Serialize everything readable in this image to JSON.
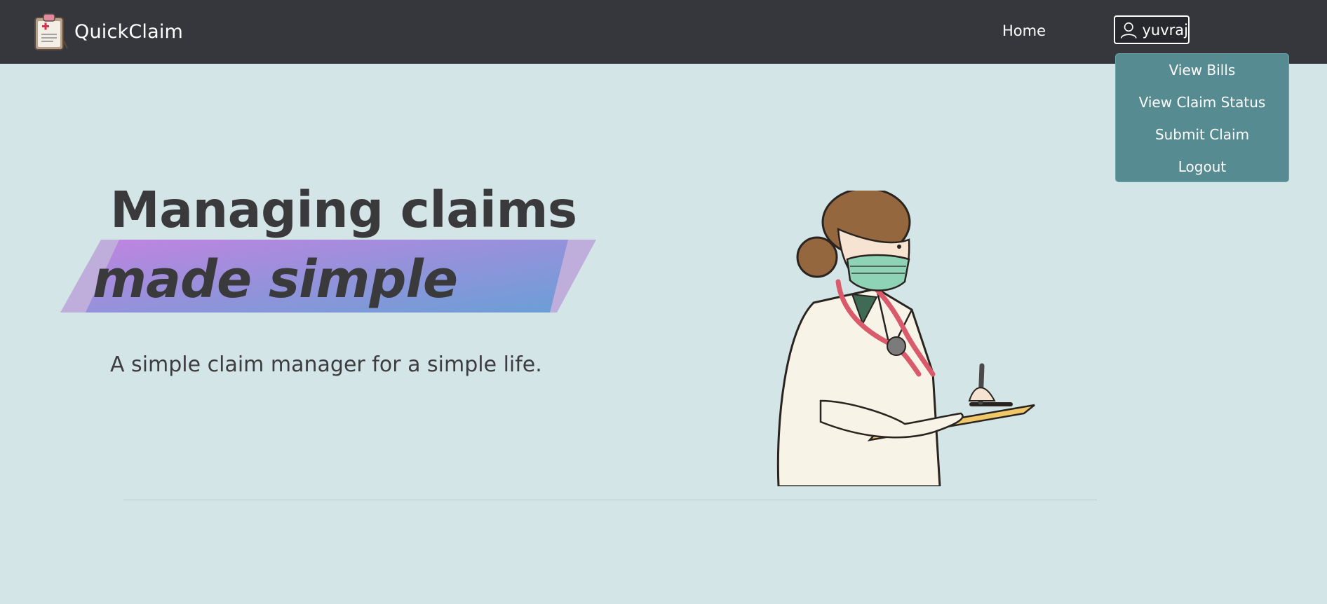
{
  "navbar": {
    "brand_name": "QuickClaim",
    "logo_icon": "clipboard-medical-icon",
    "home_label": "Home",
    "user_label": "yuvraj",
    "user_icon": "user-icon",
    "background": "#35373d"
  },
  "user_menu": {
    "items": [
      {
        "label": "View Bills"
      },
      {
        "label": "View Claim Status"
      },
      {
        "label": "Submit Claim"
      },
      {
        "label": "Logout"
      }
    ],
    "background": "#558b91"
  },
  "hero": {
    "title": "Managing claims",
    "highlight": "made simple",
    "subtitle": "A simple claim manager for a simple life.",
    "illustration": "doctor-writing-on-clipboard",
    "highlight_gradient": [
      "#c084e0",
      "#6a9fd6"
    ]
  },
  "page": {
    "background": "#d4e5e7"
  }
}
